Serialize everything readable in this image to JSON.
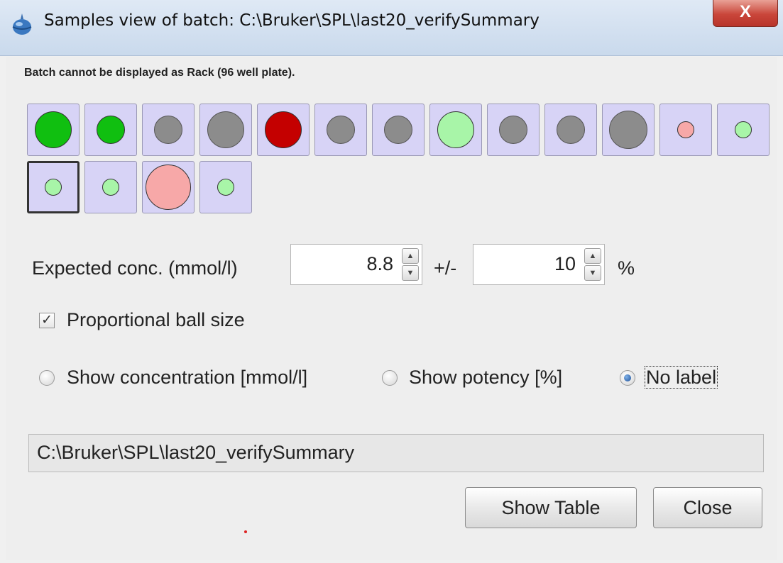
{
  "window": {
    "title": "Samples view of batch: C:\\Bruker\\SPL\\last20_verifySummary",
    "close_glyph": "X"
  },
  "warning": "Batch cannot be displayed as Rack (96 well plate).",
  "rack": {
    "wells": [
      {
        "color": "#10bf10",
        "size": "large"
      },
      {
        "color": "#10bf10",
        "size": "medium"
      },
      {
        "color": "#8c8c8c",
        "size": "medium"
      },
      {
        "color": "#8c8c8c",
        "size": "large"
      },
      {
        "color": "#c40000",
        "size": "large"
      },
      {
        "color": "#8c8c8c",
        "size": "medium"
      },
      {
        "color": "#8c8c8c",
        "size": "medium"
      },
      {
        "color": "#a8f5a8",
        "size": "large"
      },
      {
        "color": "#8c8c8c",
        "size": "medium"
      },
      {
        "color": "#8c8c8c",
        "size": "medium"
      },
      {
        "color": "#8c8c8c",
        "size": "xlarge"
      },
      {
        "color": "#f7a8a8",
        "size": "small"
      },
      {
        "color": "#a8f5a8",
        "size": "small"
      },
      {
        "color": "#a8f5a8",
        "size": "small",
        "selected": true
      },
      {
        "color": "#a8f5a8",
        "size": "small"
      },
      {
        "color": "#f7a8a8",
        "size": "xxlarge"
      },
      {
        "color": "#a8f5a8",
        "size": "small"
      }
    ]
  },
  "expected_conc": {
    "label": "Expected conc. (mmol/l)",
    "value": "8.8",
    "pm_label": "+/-",
    "tolerance": "10",
    "unit": "%"
  },
  "proportional": {
    "label": "Proportional ball size",
    "checked": true
  },
  "label_mode": {
    "options": [
      "Show concentration [mmol/l]",
      "Show potency [%]",
      "No label"
    ],
    "selected": "No label"
  },
  "path": "C:\\Bruker\\SPL\\last20_verifySummary",
  "buttons": {
    "show_table": "Show Table",
    "close": "Close"
  }
}
